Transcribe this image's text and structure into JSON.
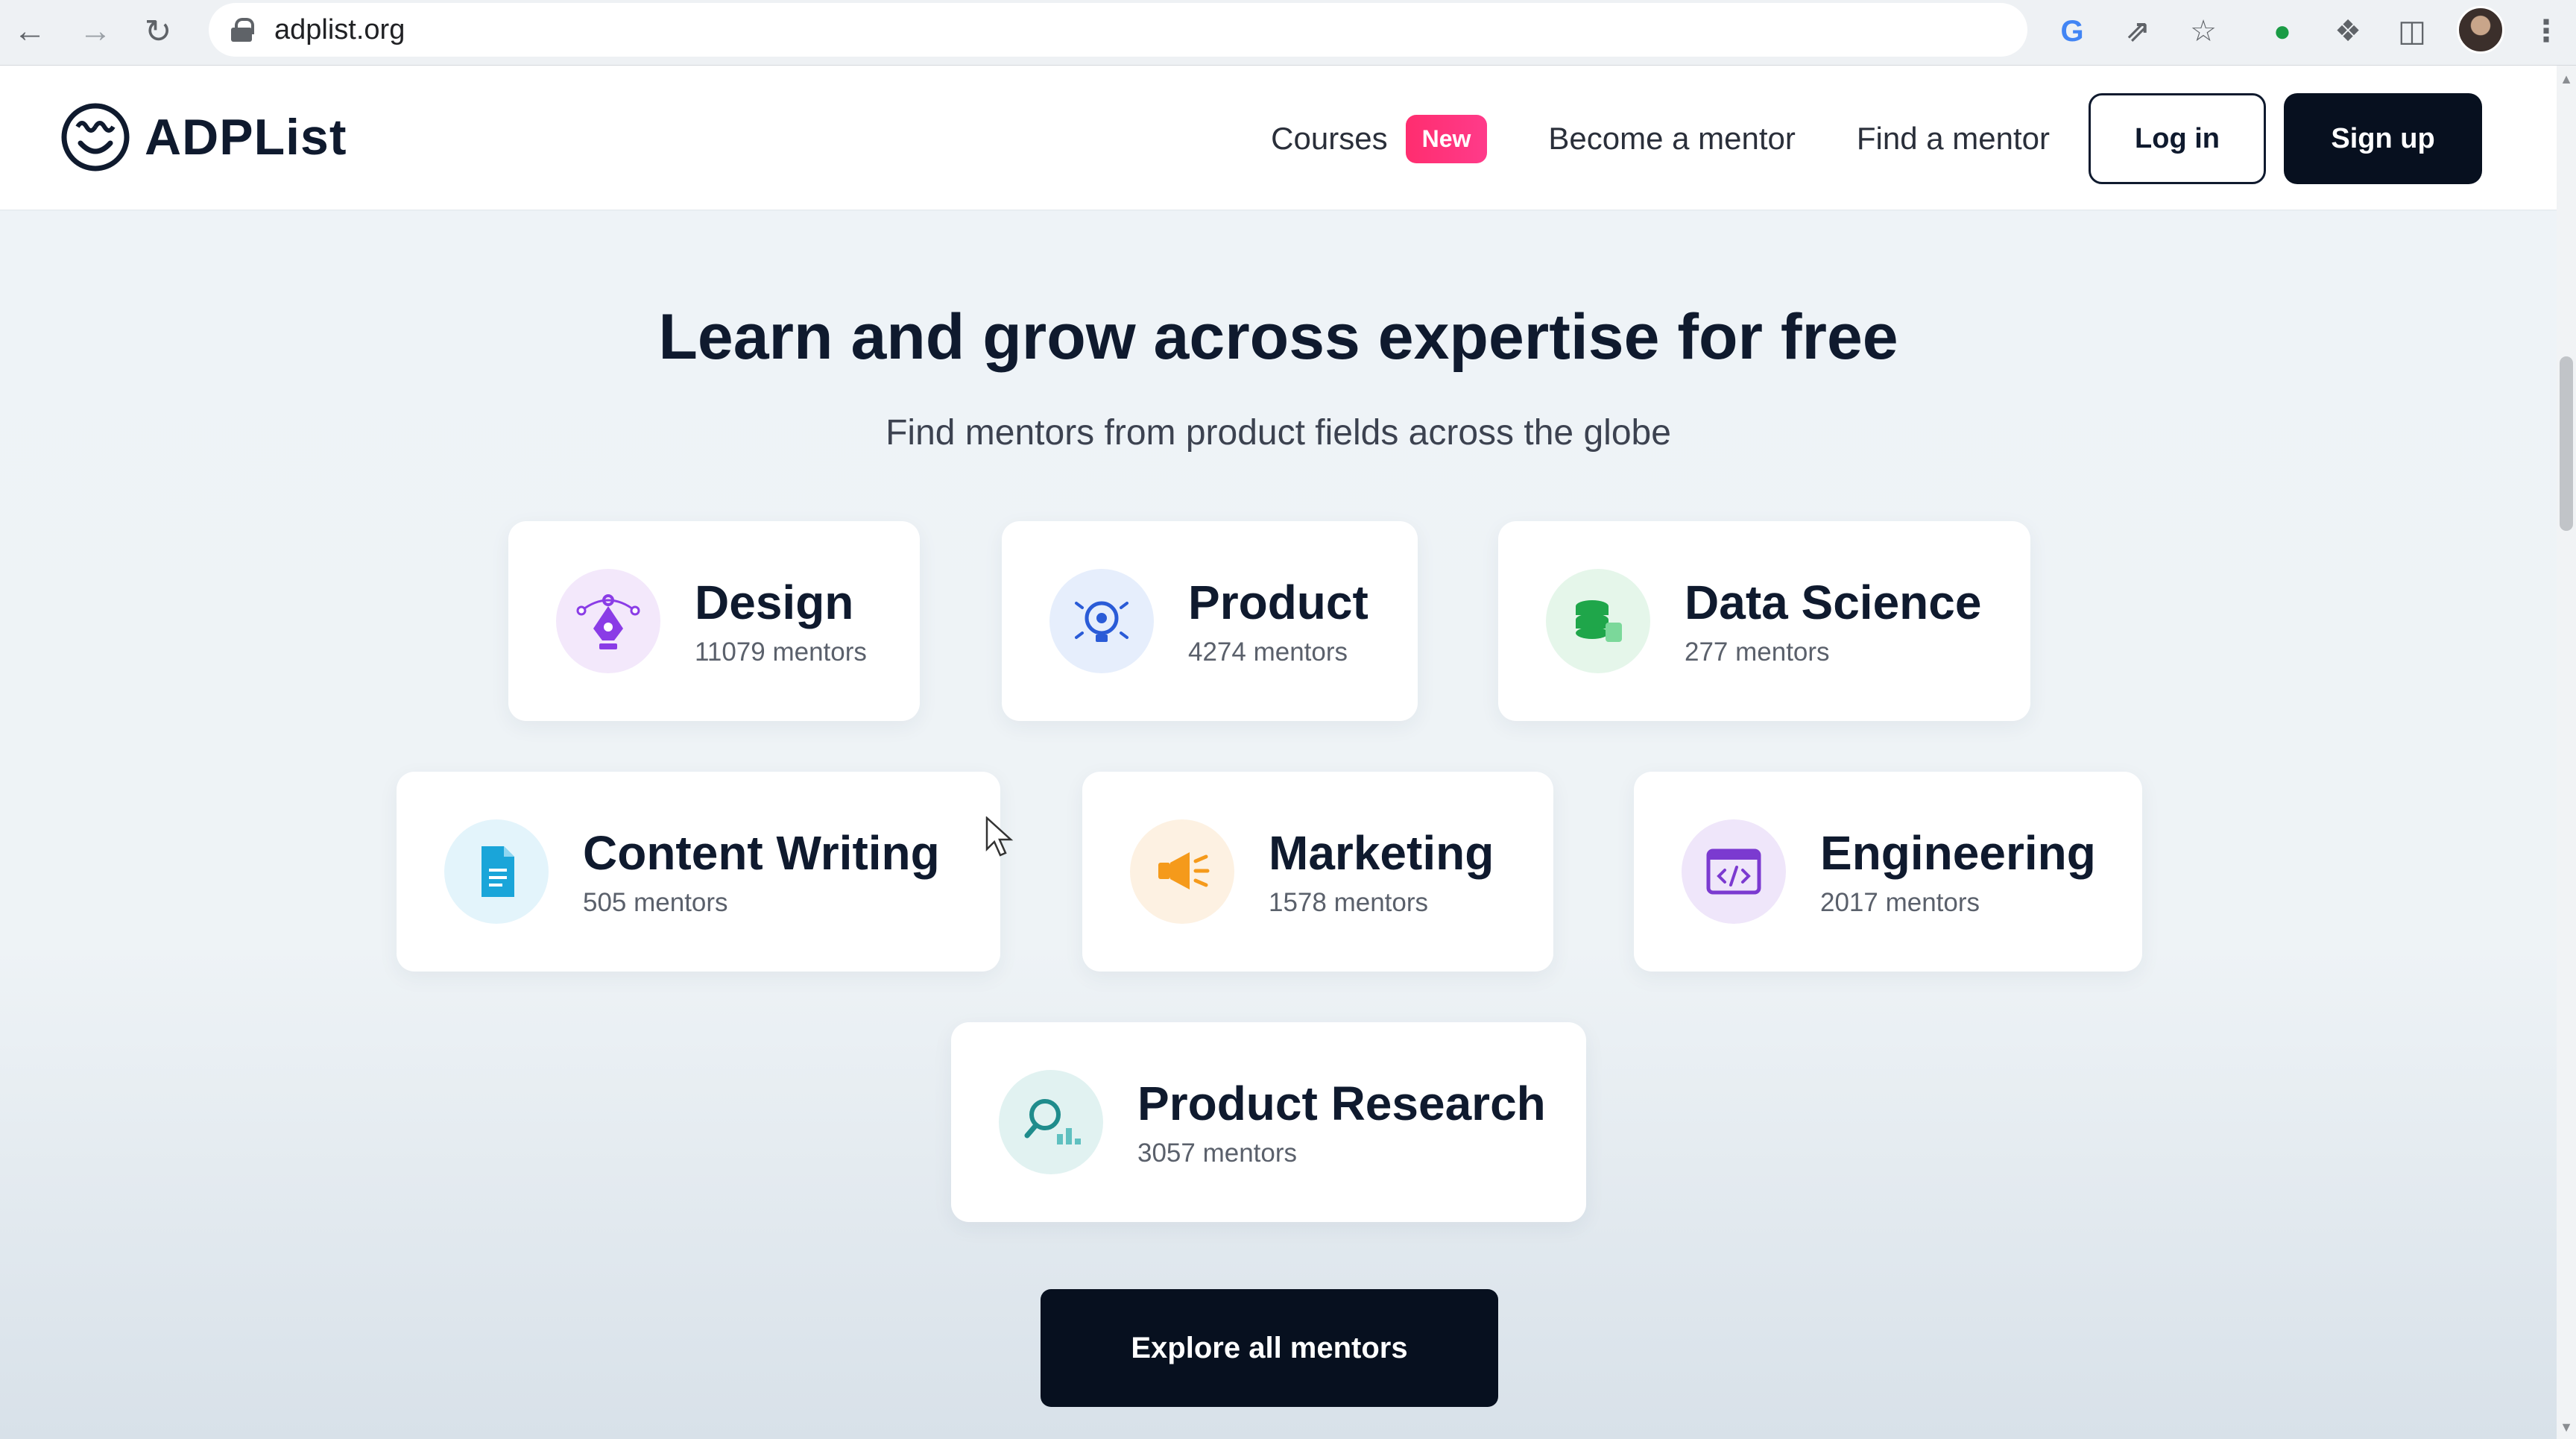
{
  "browser": {
    "url": "adplist.org",
    "back_icon": "arrow-left",
    "forward_icon": "arrow-right",
    "reload_icon": "reload",
    "toolbar_icons": [
      "google-icon",
      "share-icon",
      "star-icon",
      "extension-green-icon",
      "puzzle-icon",
      "sidepanel-icon",
      "profile-avatar",
      "kebab-menu-icon"
    ]
  },
  "header": {
    "brand": "ADPList",
    "nav": {
      "courses": "Courses",
      "new_badge": "New",
      "become_mentor": "Become a mentor",
      "find_mentor": "Find a mentor"
    },
    "login": "Log in",
    "signup": "Sign up"
  },
  "hero": {
    "title": "Learn and grow across expertise for free",
    "subtitle": "Find mentors from product fields across the globe"
  },
  "categories": [
    {
      "title": "Design",
      "count": "11079 mentors",
      "icon": "pen-tool-icon"
    },
    {
      "title": "Product",
      "count": "4274 mentors",
      "icon": "lightbulb-icon"
    },
    {
      "title": "Data Science",
      "count": "277 mentors",
      "icon": "database-stack-icon"
    },
    {
      "title": "Content Writing",
      "count": "505 mentors",
      "icon": "document-icon"
    },
    {
      "title": "Marketing",
      "count": "1578 mentors",
      "icon": "megaphone-icon"
    },
    {
      "title": "Engineering",
      "count": "2017 mentors",
      "icon": "code-window-icon"
    },
    {
      "title": "Product Research",
      "count": "3057 mentors",
      "icon": "magnifier-chart-icon"
    }
  ],
  "cta": {
    "explore": "Explore all mentors"
  },
  "colors": {
    "brand_dark": "#0f1a2e",
    "badge": "#ff2d6f",
    "design": "#8a3ce6",
    "product": "#2a5bd7",
    "data_science": "#1fa64a",
    "content_writing": "#1aa5d9",
    "marketing": "#f59a1b",
    "engineering": "#7b3ad0",
    "research": "#1f8c8c"
  }
}
